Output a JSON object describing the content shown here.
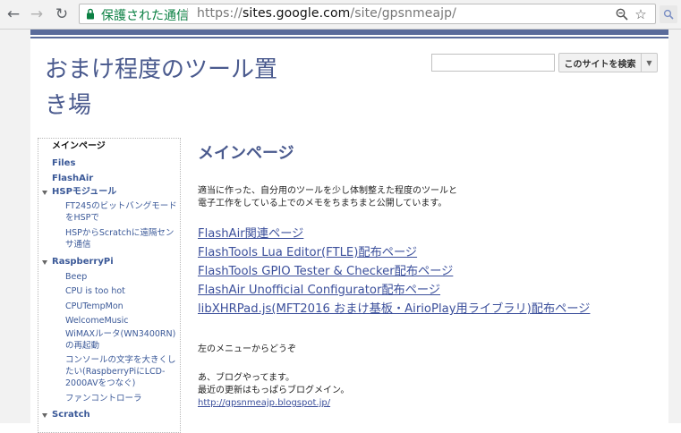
{
  "browser": {
    "secure_label": "保護された通信",
    "url_scheme": "https://",
    "url_host": "sites.google.com",
    "url_path": "/site/gpsnmeajp/"
  },
  "site": {
    "title_line1": "おまけ程度のツール置",
    "title_line2": "き場",
    "search_button": "このサイトを検索",
    "search_value": ""
  },
  "sidebar": {
    "current": "メインページ",
    "files": "Files",
    "flashair": "FlashAir",
    "hsp_group": "HSPモジュール",
    "hsp_items": [
      "FT245のビットバングモードをHSPで",
      "HSPからScratchに遠隔センサ通信"
    ],
    "rpi_group": "RaspberryPi",
    "rpi_items": [
      "Beep",
      "CPU is too hot",
      "CPUTempMon",
      "WelcomeMusic",
      "WiMAXルータ(WN3400RN)の再起動",
      "コンソールの文字を大きくしたい(RaspberryPiにLCD-2000AVをつなぐ)",
      "ファンコントローラ"
    ],
    "scratch_group": "Scratch"
  },
  "main": {
    "title": "メインページ",
    "desc_line1": "適当に作った、自分用のツールを少し体制整えた程度のツールと",
    "desc_line2": "電子工作をしている上でのメモをちまちまと公開しています。",
    "links": [
      "FlashAir関連ページ",
      "FlashTools Lua Editor(FTLE)配布ページ",
      "FlashTools GPIO Tester & Checker配布ページ",
      "FlashAir Unofficial Configurator配布ページ",
      "libXHRPad.js(MFT2016 おまけ基板・AirioPlay用ライブラリ)配布ページ"
    ],
    "menu_note": "左のメニューからどうぞ",
    "blog_line1": "あ、ブログやってます。",
    "blog_line2": "最近の更新はもっぱらブログメイン。",
    "blog_url": "http://gpsnmeajp.blogspot.jp/"
  },
  "colors": {
    "title": "#4a5a8e",
    "link": "#3b4f9b",
    "header_bar": "#5a6b9b",
    "secure": "#0b8043"
  },
  "icons": [
    "back-arrow-icon",
    "forward-arrow-icon",
    "reload-icon",
    "lock-icon",
    "zoom-icon",
    "star-icon",
    "extension-icon"
  ]
}
